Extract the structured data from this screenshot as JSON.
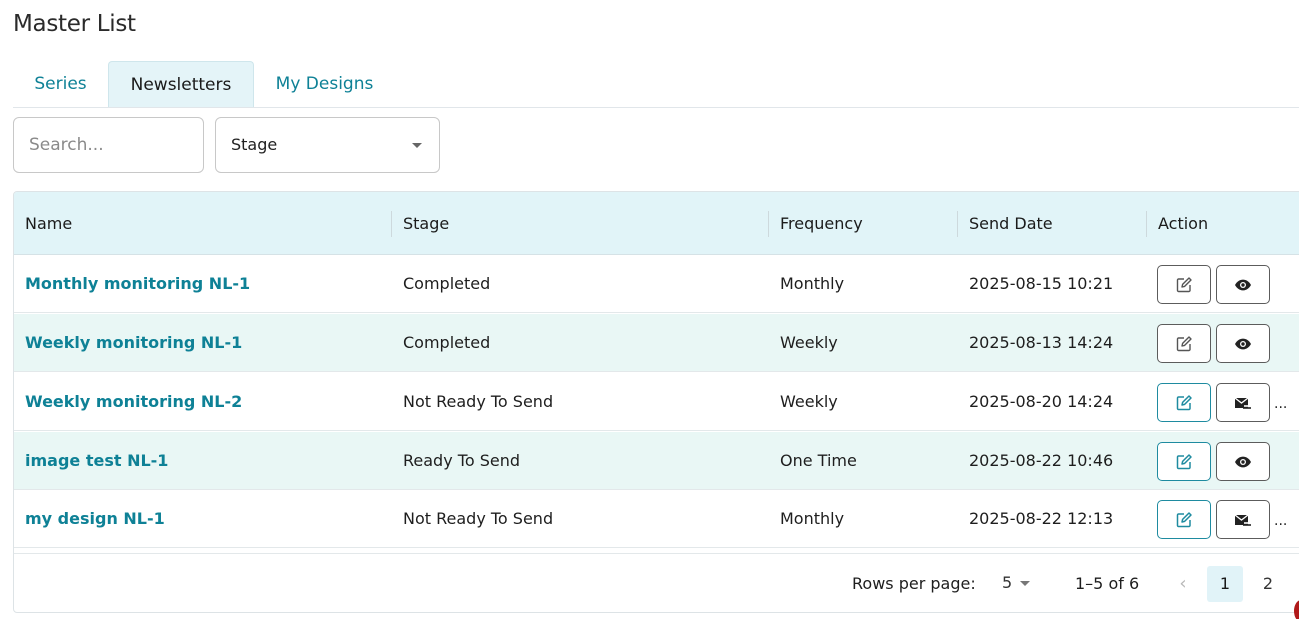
{
  "page": {
    "title": "Master List"
  },
  "tabs": [
    {
      "label": "Series",
      "active": false
    },
    {
      "label": "Newsletters",
      "active": true
    },
    {
      "label": "My Designs",
      "active": false
    }
  ],
  "filters": {
    "search_placeholder": "Search...",
    "search_value": "",
    "stage_label": "Stage"
  },
  "table": {
    "columns": [
      "Name",
      "Stage",
      "Frequency",
      "Send Date",
      "Action"
    ],
    "rows": [
      {
        "name": "Monthly monitoring NL-1",
        "stage": "Completed",
        "frequency": "Monthly",
        "send_date": "2025-08-15 10:21",
        "actions": [
          "edit-icon",
          "eye-icon"
        ],
        "more": false
      },
      {
        "name": "Weekly monitoring NL-1",
        "stage": "Completed",
        "frequency": "Weekly",
        "send_date": "2025-08-13 14:24",
        "actions": [
          "edit-icon",
          "eye-icon"
        ],
        "more": false
      },
      {
        "name": "Weekly monitoring NL-2",
        "stage": "Not Ready To Send",
        "frequency": "Weekly",
        "send_date": "2025-08-20 14:24",
        "actions": [
          "edit-icon",
          "send-mail-icon"
        ],
        "more": true
      },
      {
        "name": "image test NL-1",
        "stage": "Ready To Send",
        "frequency": "One Time",
        "send_date": "2025-08-22 10:46",
        "actions": [
          "edit-icon",
          "eye-icon"
        ],
        "more": false
      },
      {
        "name": "my design NL-1",
        "stage": "Not Ready To Send",
        "frequency": "Monthly",
        "send_date": "2025-08-22 12:13",
        "actions": [
          "edit-icon",
          "send-mail-icon"
        ],
        "more": true
      }
    ]
  },
  "pagination": {
    "rows_per_page_label": "Rows per page:",
    "rows_per_page": "5",
    "range": "1–5 of 6",
    "pages": [
      "1",
      "2"
    ],
    "current_page": "1"
  },
  "more_label": "...",
  "colors": {
    "accent": "#0e8196",
    "header_bg": "#e1f4f8",
    "alt_row_bg": "#e9f7f5"
  }
}
